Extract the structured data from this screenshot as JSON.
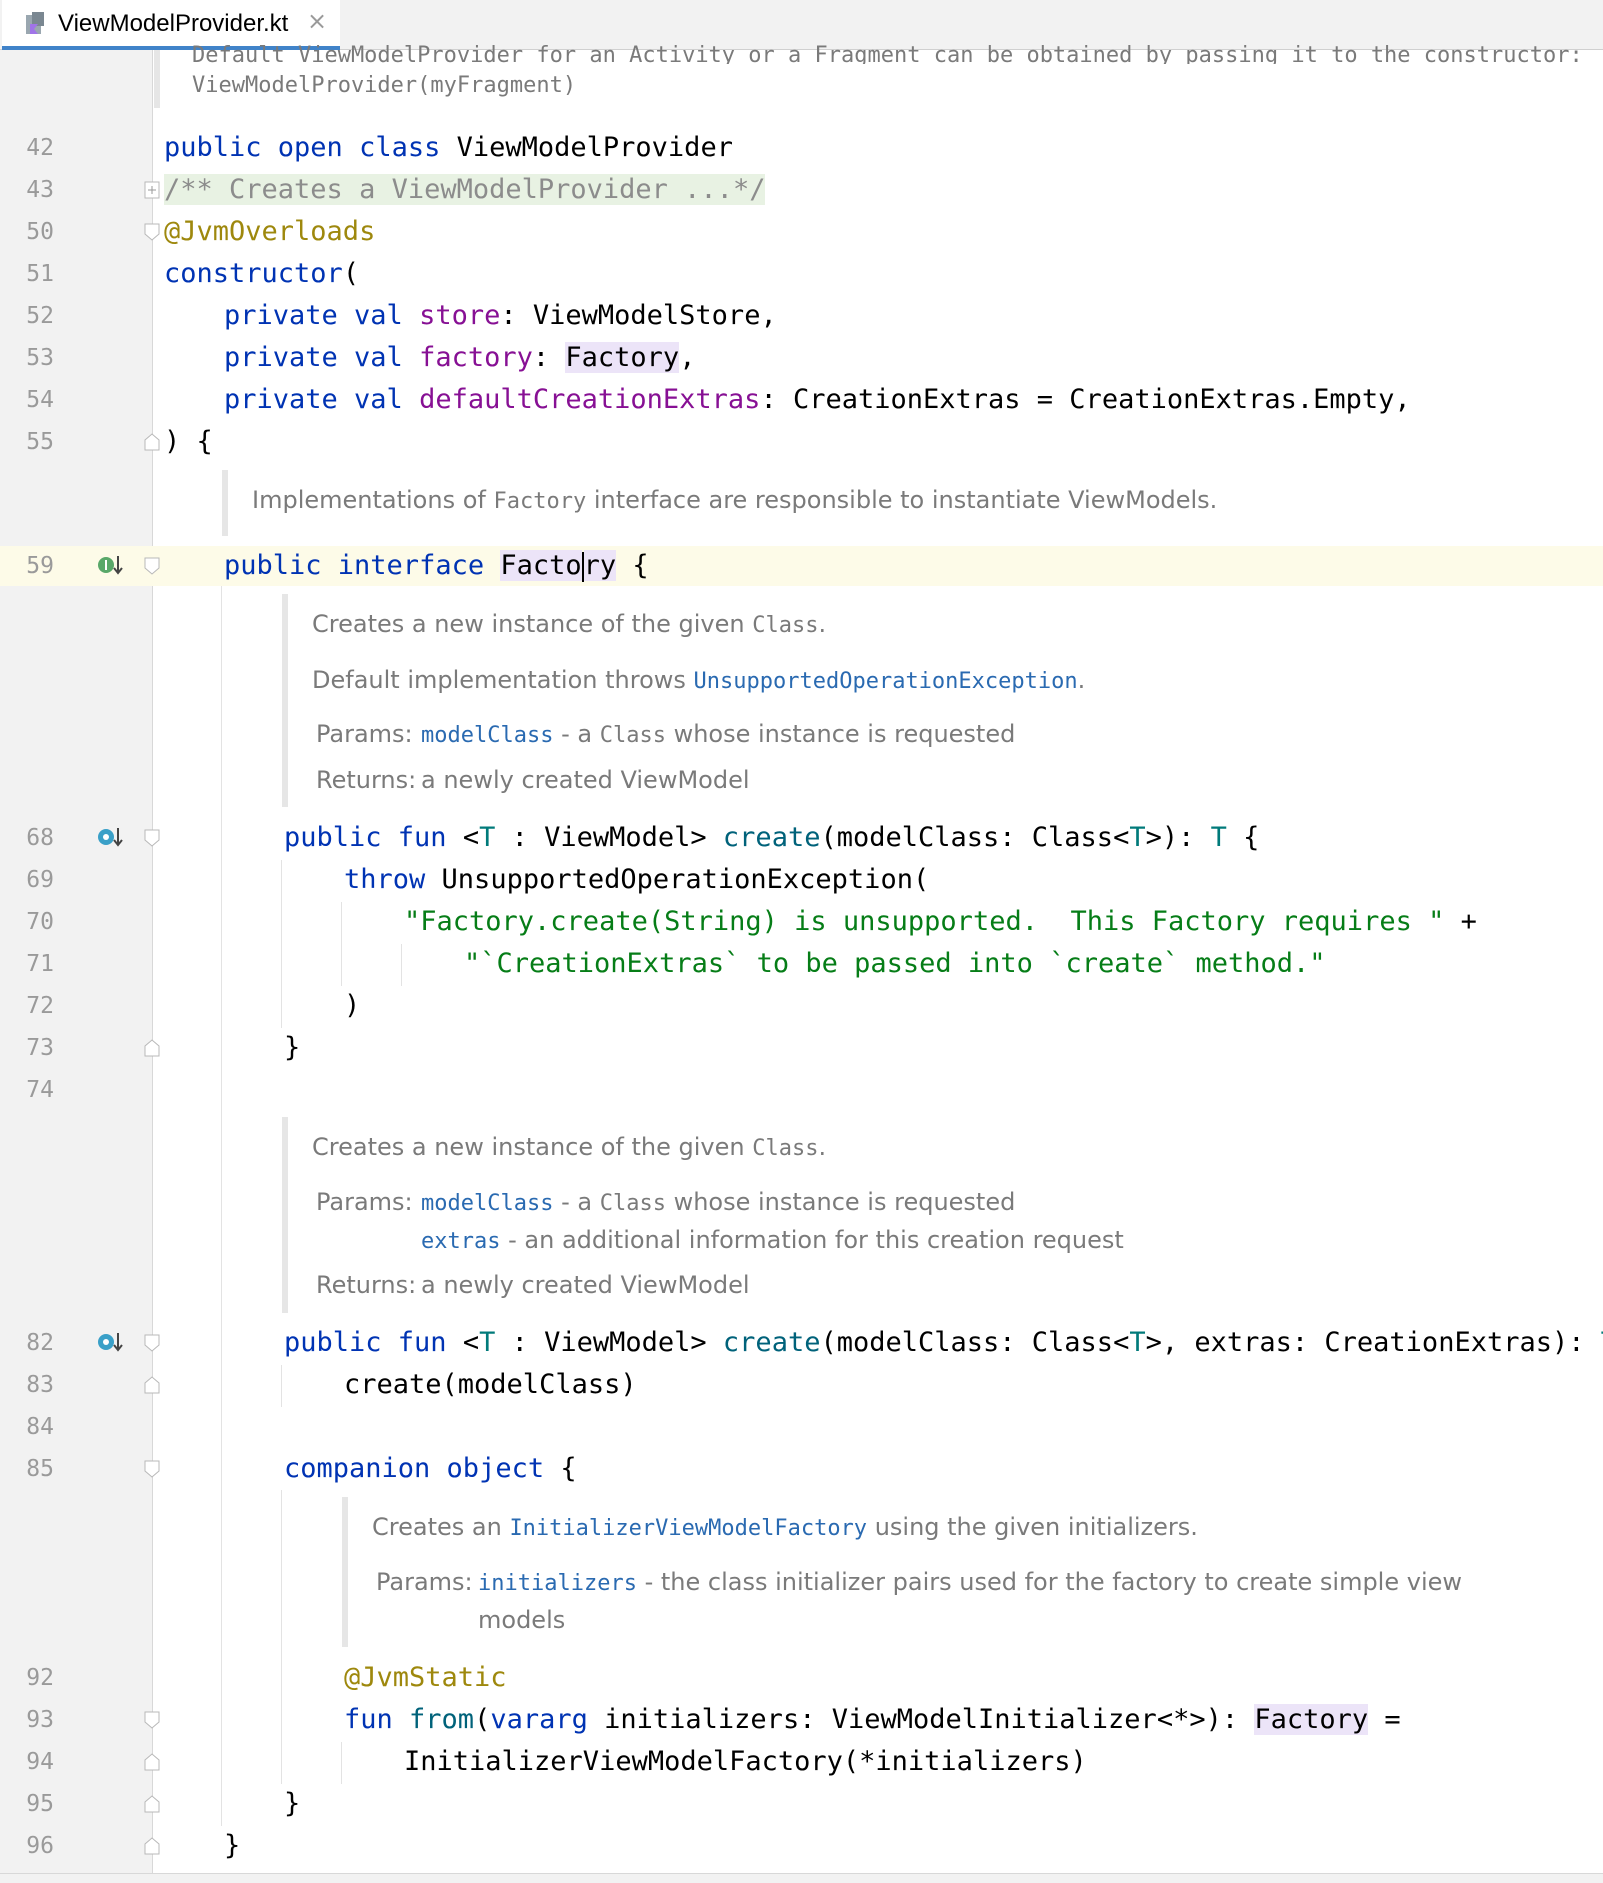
{
  "tab": {
    "filename": "ViewModelProvider.kt",
    "close_glyph": "×",
    "icon": "kotlin-file-icon"
  },
  "top_doc": {
    "line1": "Default ViewModelProvider for an Activity or a Fragment can be obtained by passing it to the constructor:",
    "line2": "ViewModelProvider(myFragment)"
  },
  "line_numbers": [
    "42",
    "43",
    "50",
    "51",
    "52",
    "53",
    "54",
    "55",
    "59",
    "68",
    "69",
    "70",
    "71",
    "72",
    "73",
    "74",
    "82",
    "83",
    "84",
    "85",
    "92",
    "93",
    "94",
    "95",
    "96"
  ],
  "code": {
    "l42": {
      "kw": "public open class ",
      "name": "ViewModelProvider"
    },
    "l43": {
      "text": "/** Creates a ViewModelProvider ...*/"
    },
    "l50": {
      "text": "@JvmOverloads"
    },
    "l51": {
      "kw": "constructor",
      "rest": "("
    },
    "l52": {
      "kw": "private val ",
      "prop": "store",
      "rest": ": ViewModelStore,"
    },
    "l53": {
      "kw": "private val ",
      "prop": "factory",
      "sep": ": ",
      "type": "Factory",
      "rest": ","
    },
    "l54": {
      "kw": "private val ",
      "prop": "defaultCreationExtras",
      "rest": ": CreationExtras = CreationExtras.Empty,"
    },
    "l55": {
      "text": ") {"
    },
    "l59": {
      "kw": "public interface ",
      "name1": "Facto",
      "name2": "ry",
      "rest": " {"
    },
    "l68": {
      "kw1": "public fun ",
      "p1": "<",
      "tp1": "T",
      "p2": " : ViewModel> ",
      "fn": "create",
      "p3": "(modelClass: Class<",
      "tp2": "T",
      "p4": ">): ",
      "tp3": "T",
      "p5": " {"
    },
    "l69": {
      "kw": "throw ",
      "rest": "UnsupportedOperationException("
    },
    "l70": {
      "str": "\"Factory.create(String) is unsupported.  This Factory requires \"",
      "rest": " +"
    },
    "l71": {
      "str": "\"`CreationExtras` to be passed into `create` method.\""
    },
    "l72": {
      "text": ")"
    },
    "l73": {
      "text": "}"
    },
    "l82": {
      "kw1": "public fun ",
      "p1": "<",
      "tp1": "T",
      "p2": " : ViewModel> ",
      "fn": "create",
      "p3": "(modelClass: Class<",
      "tp2": "T",
      "p4": ">, extras: CreationExtras): ",
      "tp3": "T",
      "p5": " ="
    },
    "l83": {
      "text": "create(modelClass)"
    },
    "l85": {
      "kw": "companion object",
      "rest": " {"
    },
    "l92": {
      "text": "@JvmStatic"
    },
    "l93": {
      "kw1": "fun ",
      "fn": "from",
      "p1": "(",
      "kw2": "vararg",
      "p2": " initializers: ViewModelInitializer<*>): ",
      "type": "Factory",
      "p3": " ="
    },
    "l94": {
      "text": "InitializerViewModelFactory(*initializers)"
    },
    "l95": {
      "text": "}"
    },
    "l96": {
      "text": "}"
    }
  },
  "docs": {
    "factory_iface": {
      "pre": "Implementations of ",
      "code": "Factory",
      "post": " interface are responsible to instantiate ViewModels."
    },
    "create1": {
      "l1_pre": "Creates a new instance of the given ",
      "l1_code": "Class",
      "l1_post": ".",
      "l2_pre": "Default implementation throws ",
      "l2_link": "UnsupportedOperationException",
      "l2_post": ".",
      "params_label": "Params:",
      "param1_name": "modelClass",
      "param1_pre": " - a ",
      "param1_code": "Class",
      "param1_post": " whose instance is requested",
      "returns_label": "Returns:",
      "returns_text": "a newly created ViewModel"
    },
    "create2": {
      "l1_pre": "Creates a new instance of the given ",
      "l1_code": "Class",
      "l1_post": ".",
      "params_label": "Params:",
      "param1_name": "modelClass",
      "param1_pre": " - a ",
      "param1_code": "Class",
      "param1_post": " whose instance is requested",
      "param2_name": "extras",
      "param2_text": " - an additional information for this creation request",
      "returns_label": "Returns:",
      "returns_text": "a newly created ViewModel"
    },
    "from": {
      "l1_pre": "Creates an ",
      "l1_link": "InitializerViewModelFactory",
      "l1_post": " using the given initializers.",
      "params_label": "Params:",
      "param1_name": "initializers",
      "param1_text": " - the class initializer pairs used for the factory to create simple view",
      "param1_cont": "models"
    }
  },
  "gutter_icons": {
    "l59": "implemented-interface-icon",
    "l68": "implemented-method-icon",
    "l82": "implemented-method-icon"
  },
  "colors": {
    "keyword": "#0033b3",
    "function": "#00627a",
    "property": "#871094",
    "string": "#067d17",
    "annotation": "#9e880d",
    "comment": "#8c8c8c",
    "tab_underline": "#4083c9",
    "caret_row": "#fdfbe8"
  }
}
